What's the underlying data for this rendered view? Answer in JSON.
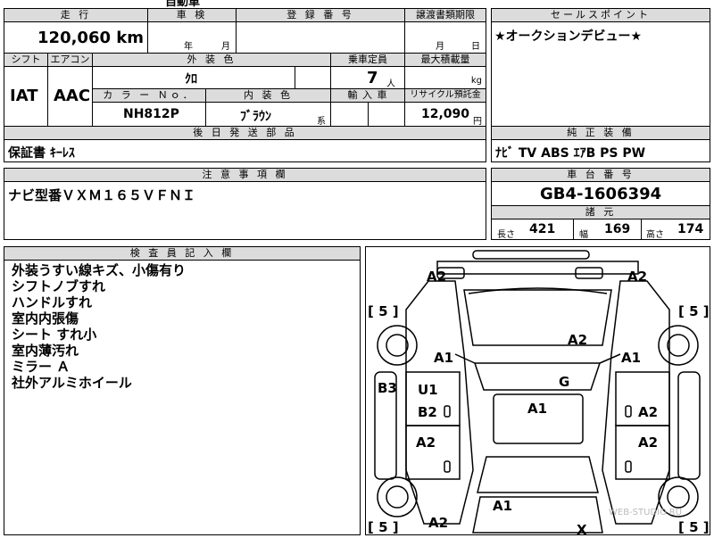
{
  "top_cut": {
    "text": "自動車"
  },
  "mileage": {
    "header": "走 行",
    "value": "120,060 km"
  },
  "inspection": {
    "header": "車 検",
    "year_label": "年",
    "month_label": "月"
  },
  "registration": {
    "header": "登 録 番 号"
  },
  "transfer_deadline": {
    "header": "譲渡書類期限",
    "month_label": "月",
    "day_label": "日"
  },
  "sales_point": {
    "header": "セールスポイント",
    "text": "★オークションデビュー★"
  },
  "shift": {
    "header": "シフト",
    "value": "IAT"
  },
  "aircon": {
    "header": "エアコン",
    "value": "AAC"
  },
  "exterior_color": {
    "header": "外 装 色",
    "value": "ｸﾛ"
  },
  "capacity": {
    "header": "乗車定員",
    "value": "7",
    "unit": "人"
  },
  "max_load": {
    "header": "最大積載量",
    "unit": "kg"
  },
  "color_no": {
    "header": "カ ラ ー Ｎｏ．",
    "value": "NH812P"
  },
  "interior_color": {
    "header": "内 装 色",
    "value": "ﾌﾞﾗｳﾝ",
    "suffix": "系"
  },
  "import": {
    "header": "輸 入 車"
  },
  "recycle": {
    "header": "リサイクル預託金",
    "value": "12,090",
    "unit": "円"
  },
  "later_parts": {
    "header": "後 日 発 送 部 品",
    "value": "保証書 ｷｰﾚｽ"
  },
  "equipment": {
    "header": "純 正 装 備",
    "value": "ﾅﾋﾞ TV ABS ｴｱB PS PW"
  },
  "notice": {
    "header": "注 意 事 項 欄",
    "value": "ナビ型番ＶＸＭ１６５ＶＦＮＩ"
  },
  "chassis": {
    "header": "車 台 番 号",
    "value": "GB4-1606394"
  },
  "specs": {
    "header": "諸 元",
    "length_label": "長さ",
    "length": "421",
    "width_label": "幅",
    "width": "169",
    "height_label": "高さ",
    "height": "174"
  },
  "inspector_notes": {
    "header": "検 査 員 記 入 欄",
    "lines": [
      "外装うすい線キズ、小傷有り",
      "シフトノブすれ",
      "ハンドルすれ",
      "室内内張傷",
      "シート すれ小",
      "室内薄汚れ",
      "ミラー Ａ",
      "社外アルミホイール"
    ]
  },
  "diagram": {
    "marks": {
      "front_left_corner": "A2",
      "front_right_corner": "A2",
      "tire_fl": "5",
      "tire_fr": "5",
      "hood": "A2",
      "fender_left": "A1",
      "fender_right": "A1",
      "windshield": "G",
      "left_side": "B3",
      "door_fl_top": "U1",
      "door_fl_bottom": "B2",
      "roof": "A1",
      "door_fr": "A2",
      "door_rl": "A2",
      "door_rr": "A2",
      "rear_center": "A1",
      "rear_left": "A2",
      "rear_right": "X",
      "tire_rl": "5",
      "tire_rr": "5"
    }
  },
  "watermark": "WEB-STUDIO.RU"
}
